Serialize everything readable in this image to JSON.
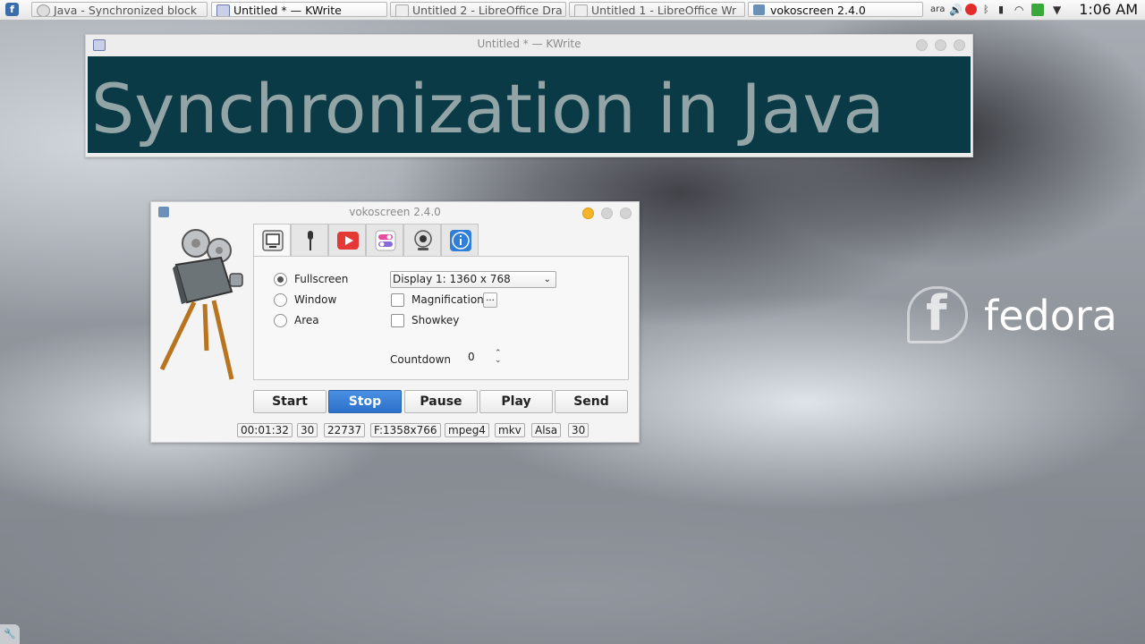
{
  "taskbar": {
    "launcher_icon": "fedora-icon",
    "tasks": [
      {
        "label": "Java - Synchronized block",
        "icon": "browser-icon"
      },
      {
        "label": "Untitled * — KWrite",
        "icon": "text-editor-icon"
      },
      {
        "label": "Untitled 2 - LibreOffice Dra",
        "icon": "draw-icon"
      },
      {
        "label": "Untitled 1 - LibreOffice Wr",
        "icon": "writer-icon"
      },
      {
        "label": "vokoscreen 2.4.0",
        "icon": "camera-icon"
      }
    ],
    "keyboard_layout": "ara",
    "clock": "1:06 AM"
  },
  "kwrite": {
    "title": "Untitled * — KWrite",
    "document_text": "Synchronization in Java"
  },
  "vokoscreen": {
    "title": "vokoscreen 2.4.0",
    "tabs": [
      "screen-icon",
      "microphone-icon",
      "video-play-icon",
      "toggle-settings-icon",
      "webcam-icon",
      "info-icon"
    ],
    "capture_modes": [
      "Fullscreen",
      "Window",
      "Area"
    ],
    "selected_mode": "Fullscreen",
    "display_select": "Display 1:  1360 x 768",
    "magnification_label": "Magnification",
    "magnification_more": "...",
    "showkey_label": "Showkey",
    "countdown_label": "Countdown",
    "countdown_value": "0",
    "buttons": {
      "start": "Start",
      "stop": "Stop",
      "pause": "Pause",
      "play": "Play",
      "send": "Send"
    },
    "status": [
      "00:01:32",
      "30",
      "22737",
      "F:1358x766",
      "mpeg4",
      "mkv",
      "Alsa",
      "30"
    ]
  },
  "desktop": {
    "logo_text": "fedora"
  },
  "colors": {
    "doc_background": "#0a3a45",
    "doc_text": "#93a4a7",
    "primary_button": "#2c70c8",
    "record_red": "#e32b2b"
  }
}
